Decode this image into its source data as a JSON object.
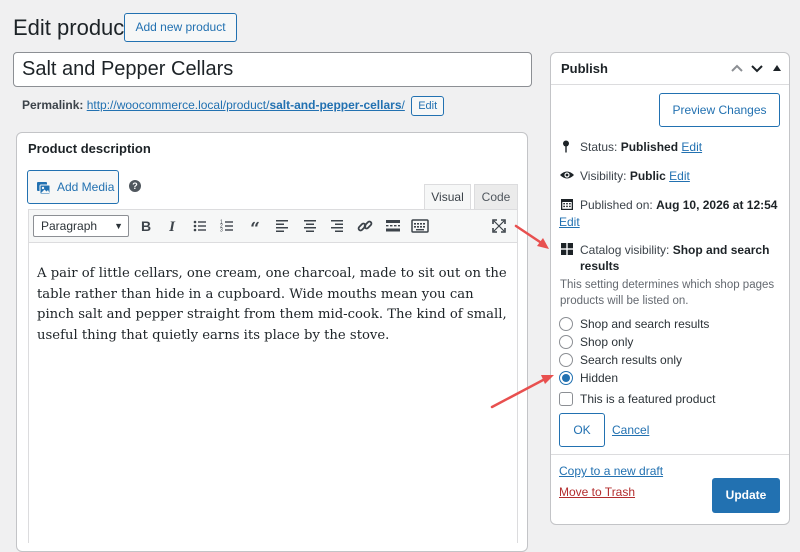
{
  "page": {
    "title": "Edit product",
    "add_new_label": "Add new product"
  },
  "product": {
    "title_value": "Salt and Pepper Cellars",
    "permalink_label": "Permalink:",
    "permalink_base": "http://woocommerce.local/product/",
    "permalink_slug": "salt-and-pepper-cellars",
    "permalink_trailing": "/",
    "permalink_edit_label": "Edit"
  },
  "description": {
    "title": "Product description",
    "add_media_label": "Add Media",
    "help_glyph": "?",
    "tab_visual": "Visual",
    "tab_code": "Code",
    "format_select": "Paragraph",
    "body": "A pair of little cellars, one cream, one charcoal, made to sit out on the table rather than hide in a cupboard. Wide mouths mean you can pinch salt and pepper straight from them mid-cook. The kind of small, useful thing that quietly earns its place by the stove.",
    "toolbar_icons": [
      "bold-icon",
      "italic-icon",
      "bulleted-list-icon",
      "numbered-list-icon",
      "blockquote-icon",
      "align-left-icon",
      "align-center-icon",
      "align-right-icon",
      "insert-link-icon",
      "read-more-icon",
      "toolbar-toggle-icon",
      "fullscreen-icon"
    ]
  },
  "publish": {
    "title": "Publish",
    "preview_label": "Preview Changes",
    "status_label": "Status:",
    "status_value": "Published",
    "visibility_label": "Visibility:",
    "visibility_value": "Public",
    "published_label": "Published on:",
    "published_value": "Aug 10, 2026 at 12:54",
    "edit_label": "Edit",
    "catalog_label": "Catalog visibility:",
    "catalog_value_line1": "Shop and search",
    "catalog_value_line2": "results",
    "helper_text": "This setting determines which shop pages products will be listed on.",
    "options": [
      {
        "label": "Shop and search results",
        "checked": false
      },
      {
        "label": "Shop only",
        "checked": false
      },
      {
        "label": "Search results only",
        "checked": false
      },
      {
        "label": "Hidden",
        "checked": true
      }
    ],
    "featured_label": "This is a featured product",
    "featured_checked": false,
    "ok_label": "OK",
    "cancel_label": "Cancel",
    "copy_draft_label": "Copy to a new draft",
    "trash_label": "Move to Trash",
    "update_label": "Update"
  },
  "colors": {
    "accent": "#2271b1",
    "trash": "#b32d2e",
    "annotation_arrow": "#e8504f"
  }
}
